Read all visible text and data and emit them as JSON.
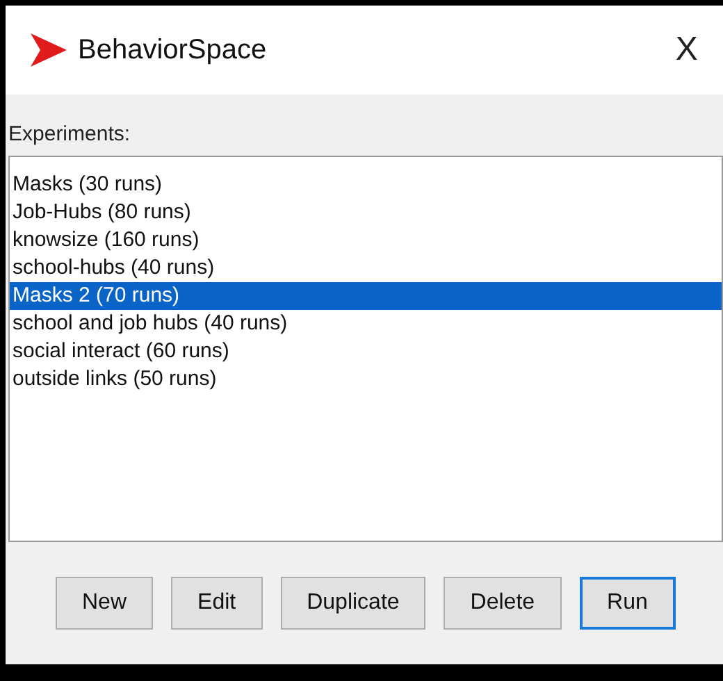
{
  "window": {
    "title": "BehaviorSpace",
    "close": "X"
  },
  "experiments_label": "Experiments:",
  "experiments": [
    {
      "label": "Masks (30 runs)",
      "selected": false
    },
    {
      "label": "Job-Hubs (80 runs)",
      "selected": false
    },
    {
      "label": "knowsize (160 runs)",
      "selected": false
    },
    {
      "label": "school-hubs (40 runs)",
      "selected": false
    },
    {
      "label": "Masks 2 (70 runs)",
      "selected": true
    },
    {
      "label": "school and job hubs (40 runs)",
      "selected": false
    },
    {
      "label": "social interact (60 runs)",
      "selected": false
    },
    {
      "label": "outside links (50 runs)",
      "selected": false
    }
  ],
  "buttons": [
    {
      "label": "New",
      "focused": false
    },
    {
      "label": "Edit",
      "focused": false
    },
    {
      "label": "Duplicate",
      "focused": false
    },
    {
      "label": "Delete",
      "focused": false
    },
    {
      "label": "Run",
      "focused": true
    }
  ]
}
